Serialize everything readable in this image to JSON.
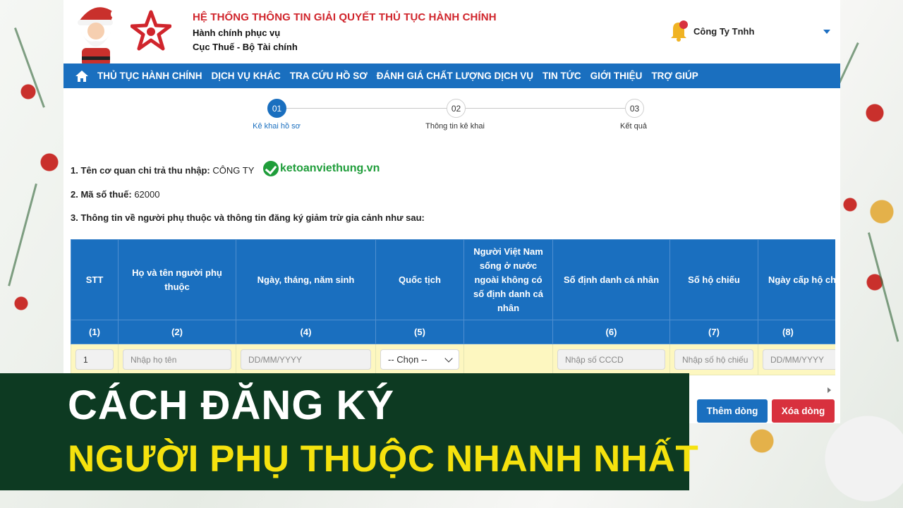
{
  "header": {
    "org_title": "HỆ THỐNG THÔNG TIN GIẢI QUYẾT THỦ TỤC HÀNH CHÍNH",
    "org_sub1": "Hành chính phục vụ",
    "org_sub2": "Cục Thuế - Bộ Tài chính",
    "user_name": "Công Ty Tnhh"
  },
  "nav": {
    "items": [
      "THỦ TỤC HÀNH CHÍNH",
      "DỊCH VỤ KHÁC",
      "TRA CỨU HỒ SƠ",
      "ĐÁNH GIÁ CHẤT LƯỢNG DỊCH VỤ",
      "TIN TỨC",
      "GIỚI THIỆU",
      "TRỢ GIÚP"
    ]
  },
  "stepper": {
    "steps": [
      {
        "num": "01",
        "label": "Kê khai hồ sơ",
        "active": true
      },
      {
        "num": "02",
        "label": "Thông tin kê khai",
        "active": false
      },
      {
        "num": "03",
        "label": "Kết quả",
        "active": false
      }
    ]
  },
  "info": {
    "line1_label": "1. Tên cơ quan chi trả thu nhập:",
    "line1_value": "CÔNG TY",
    "line2_label": "2. Mã số thuế:",
    "line2_value": "62000",
    "line3": "3. Thông tin về người phụ thuộc và thông tin đăng ký giảm trừ gia cảnh như sau:"
  },
  "watermark": "ketoanviethung.vn",
  "table": {
    "headers": [
      "STT",
      "Họ và tên người phụ thuộc",
      "Ngày, tháng, năm sinh",
      "Quốc tịch",
      "Người Việt Nam sống ở nước ngoài không có số định danh cá nhân",
      "Số định danh cá nhân",
      "Số hộ chiếu",
      "Ngày cấp hộ chiếu"
    ],
    "numbers": [
      "(1)",
      "(2)",
      "(4)",
      "(5)",
      "",
      "(6)",
      "(7)",
      "(8)"
    ],
    "row": {
      "stt": "1",
      "name_placeholder": "Nhập họ tên",
      "dob_placeholder": "DD/MM/YYYY",
      "nationality": "-- Chọn --",
      "id_placeholder": "Nhập số CCCD",
      "passport_placeholder": "Nhập số hộ chiếu",
      "passport_date_placeholder": "DD/MM/YYYY"
    }
  },
  "buttons": {
    "add": "Thêm dòng",
    "delete": "Xóa dòng"
  },
  "banner": {
    "line1": "CÁCH ĐĂNG KÝ",
    "line2": "NGƯỜI PHỤ THUỘC NHANH NHẤT"
  },
  "colors": {
    "primary_blue": "#1a6fbf",
    "title_red": "#d0252c",
    "delete_red": "#d8313e",
    "banner_green": "#0d3a22",
    "banner_yellow": "#f5e20e",
    "row_yellow": "#fdf7c0",
    "watermark_green": "#1f9d3a"
  }
}
